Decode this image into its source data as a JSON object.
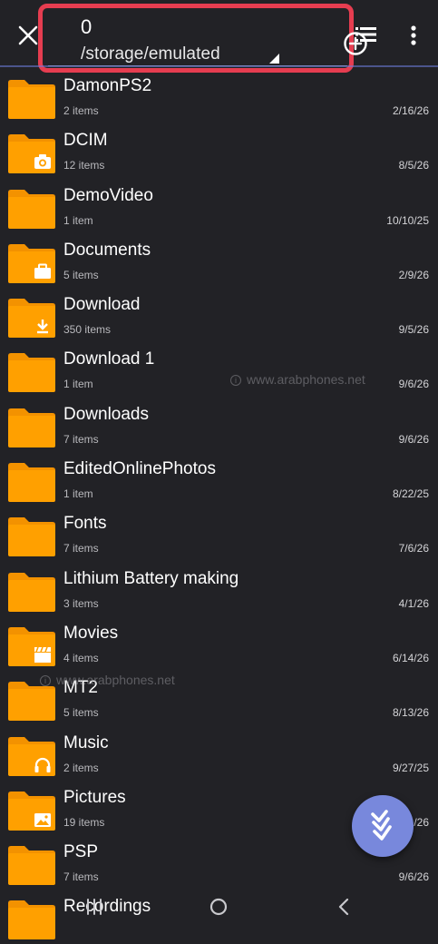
{
  "topbar": {
    "path_number": "0",
    "path": "/storage/emulated"
  },
  "colors": {
    "folder": "#ffa000",
    "folder_tab": "#f39200",
    "highlight_border": "#e63d50",
    "accent": "#7888dc",
    "background": "#222226"
  },
  "icons": {
    "close": "close-icon",
    "add": "add-circle-icon",
    "view": "list-view-icon",
    "more": "more-vert-icon",
    "fab": "double-chevron-down-icon"
  },
  "folders": [
    {
      "name": "DamonPS2",
      "count": "2 items",
      "date": "2/16/26",
      "emblem": ""
    },
    {
      "name": "DCIM",
      "count": "12 items",
      "date": "8/5/26",
      "emblem": "camera"
    },
    {
      "name": "DemoVideo",
      "count": "1 item",
      "date": "10/10/25",
      "emblem": ""
    },
    {
      "name": "Documents",
      "count": "5 items",
      "date": "2/9/26",
      "emblem": "briefcase"
    },
    {
      "name": "Download",
      "count": "350 items",
      "date": "9/5/26",
      "emblem": "download"
    },
    {
      "name": "Download 1",
      "count": "1 item",
      "date": "9/6/26",
      "emblem": ""
    },
    {
      "name": "Downloads",
      "count": "7 items",
      "date": "9/6/26",
      "emblem": ""
    },
    {
      "name": "EditedOnlinePhotos",
      "count": "1 item",
      "date": "8/22/25",
      "emblem": ""
    },
    {
      "name": "Fonts",
      "count": "7 items",
      "date": "7/6/26",
      "emblem": ""
    },
    {
      "name": "Lithium Battery making",
      "count": "3 items",
      "date": "4/1/26",
      "emblem": ""
    },
    {
      "name": "Movies",
      "count": "4 items",
      "date": "6/14/26",
      "emblem": "clapperboard"
    },
    {
      "name": "MT2",
      "count": "5 items",
      "date": "8/13/26",
      "emblem": ""
    },
    {
      "name": "Music",
      "count": "2 items",
      "date": "9/27/25",
      "emblem": "headphones"
    },
    {
      "name": "Pictures",
      "count": "19 items",
      "date": "/26",
      "emblem": "image"
    },
    {
      "name": "PSP",
      "count": "7 items",
      "date": "9/6/26",
      "emblem": ""
    },
    {
      "name": "Recordings",
      "count": "",
      "date": "",
      "emblem": ""
    }
  ],
  "watermarks": [
    "www.arabphones.net",
    "www.arabphones.net"
  ]
}
